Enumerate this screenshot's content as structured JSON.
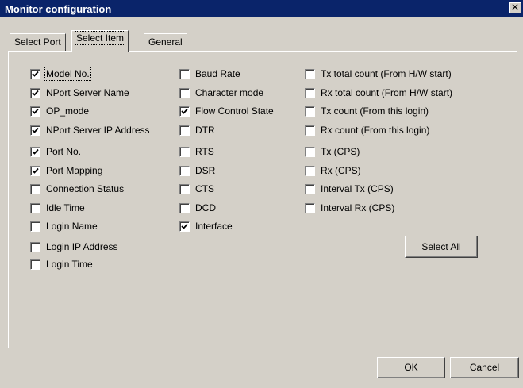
{
  "window": {
    "title": "Monitor configuration",
    "close_label": "✕"
  },
  "tabs": [
    {
      "label": "Select Port",
      "active": false
    },
    {
      "label": "Select Item",
      "active": true
    },
    {
      "label": "General",
      "active": false
    }
  ],
  "columns": [
    [
      {
        "label": "Model No.",
        "checked": true
      },
      {
        "label": "NPort Server Name",
        "checked": true
      },
      {
        "label": "OP_mode",
        "checked": true
      },
      {
        "label": "NPort Server IP Address",
        "checked": true
      },
      {
        "label": "Port No.",
        "checked": true
      },
      {
        "label": "Port Mapping",
        "checked": true
      },
      {
        "label": "Connection Status",
        "checked": false
      },
      {
        "label": "Idle Time",
        "checked": false
      },
      {
        "label": "Login Name",
        "checked": false
      },
      {
        "label": "Login IP Address",
        "checked": false
      },
      {
        "label": "Login Time",
        "checked": false
      }
    ],
    [
      {
        "label": "Baud Rate",
        "checked": false
      },
      {
        "label": "Character mode",
        "checked": false
      },
      {
        "label": "Flow Control State",
        "checked": true
      },
      {
        "label": "DTR",
        "checked": false
      },
      {
        "label": "RTS",
        "checked": false
      },
      {
        "label": "DSR",
        "checked": false
      },
      {
        "label": "CTS",
        "checked": false
      },
      {
        "label": "DCD",
        "checked": false
      },
      {
        "label": "Interface",
        "checked": true
      }
    ],
    [
      {
        "label": "Tx total count (From H/W start)",
        "checked": false
      },
      {
        "label": "Rx total count (From H/W start)",
        "checked": false
      },
      {
        "label": "Tx count (From this login)",
        "checked": false
      },
      {
        "label": "Rx count (From this login)",
        "checked": false
      },
      {
        "label": "Tx (CPS)",
        "checked": false
      },
      {
        "label": "Rx (CPS)",
        "checked": false
      },
      {
        "label": "Interval Tx (CPS)",
        "checked": false
      },
      {
        "label": "Interval Rx (CPS)",
        "checked": false
      }
    ]
  ],
  "buttons": {
    "select_all": "Select All",
    "ok": "OK",
    "cancel": "Cancel"
  }
}
